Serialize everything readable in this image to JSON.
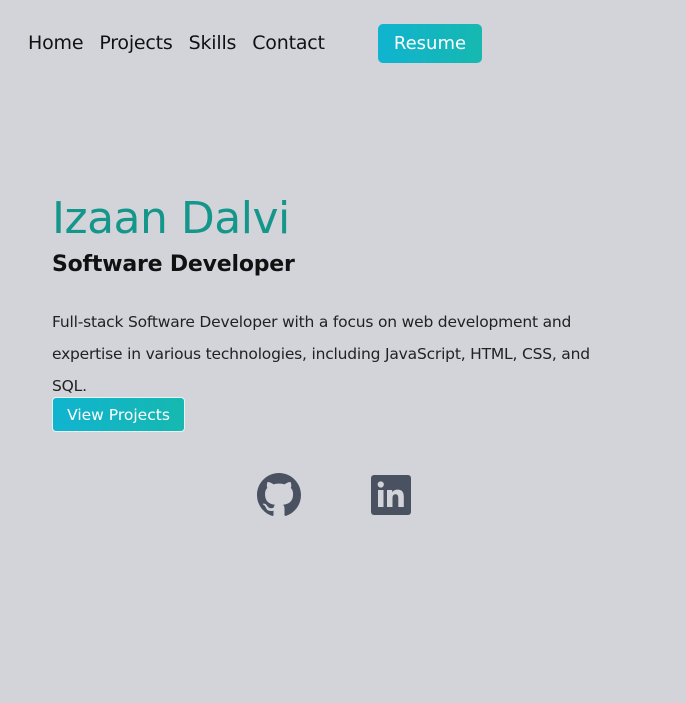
{
  "nav": {
    "links": [
      "Home",
      "Projects",
      "Skills",
      "Contact"
    ],
    "resume_label": "Resume"
  },
  "hero": {
    "name": "Izaan Dalvi",
    "role": "Software Developer",
    "description": "Full-stack Software Developer with a focus on web development and expertise in various technologies, including JavaScript, HTML, CSS, and SQL.",
    "cta_label": "View Projects"
  },
  "social": {
    "icons": [
      "github-icon",
      "linkedin-icon"
    ]
  },
  "colors": {
    "background": "#d2d4da",
    "accent": "#14968a",
    "button_gradient_start": "#10b4cf",
    "button_gradient_end": "#16b8b0",
    "icon": "#4a5160"
  }
}
